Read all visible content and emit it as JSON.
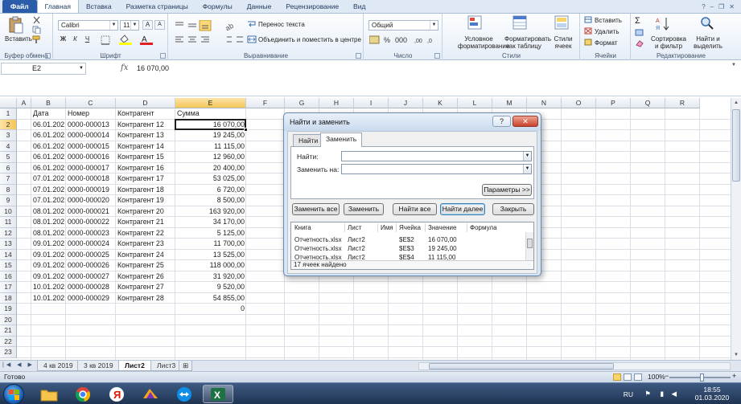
{
  "tabs": [
    "Файл",
    "Главная",
    "Вставка",
    "Разметка страницы",
    "Формулы",
    "Данные",
    "Рецензирование",
    "Вид"
  ],
  "ribbon": {
    "clipboard": {
      "paste": "Вставить",
      "label": "Буфер обмена"
    },
    "font": {
      "name": "Calibri",
      "size": "11",
      "label": "Шрифт"
    },
    "alignment": {
      "wrap": "Перенос текста",
      "merge": "Объединить и поместить в центре",
      "label": "Выравнивание"
    },
    "number": {
      "format": "Общий",
      "label": "Число"
    },
    "styles": {
      "conditional": "Условное форматирование",
      "table": "Форматировать как таблицу",
      "cell_styles": "Стили ячеек",
      "label": "Стили"
    },
    "cells": {
      "insert": "Вставить",
      "delete": "Удалить",
      "format": "Формат",
      "label": "Ячейки"
    },
    "editing": {
      "sort": "Сортировка и фильтр",
      "find": "Найти и выделить",
      "label": "Редактирование"
    }
  },
  "formula_bar": {
    "name_box": "E2",
    "fx": "fx",
    "value": "16 070,00"
  },
  "columns": [
    "A",
    "B",
    "C",
    "D",
    "E",
    "F",
    "G",
    "H",
    "I",
    "J",
    "K",
    "L",
    "M",
    "N",
    "O",
    "P",
    "Q",
    "R"
  ],
  "rows": [
    "1",
    "2",
    "3",
    "4",
    "5",
    "6",
    "7",
    "8",
    "9",
    "10",
    "11",
    "12",
    "13",
    "14",
    "15",
    "16",
    "17",
    "18",
    "19",
    "20",
    "21",
    "22",
    "23"
  ],
  "table": {
    "headers": [
      "Дата",
      "Номер",
      "Контрагент",
      "Сумма"
    ],
    "records": [
      [
        "06.01.2020",
        "0000-000013",
        "Контрагент 12",
        "16 070,00"
      ],
      [
        "06.01.2020",
        "0000-000014",
        "Контрагент 13",
        "19 245,00"
      ],
      [
        "06.01.2020",
        "0000-000015",
        "Контрагент 14",
        "11 115,00"
      ],
      [
        "06.01.2020",
        "0000-000016",
        "Контрагент 15",
        "12 960,00"
      ],
      [
        "06.01.2020",
        "0000-000017",
        "Контрагент 16",
        "20 400,00"
      ],
      [
        "07.01.2020",
        "0000-000018",
        "Контрагент 17",
        "53 025,00"
      ],
      [
        "07.01.2020",
        "0000-000019",
        "Контрагент 18",
        "6 720,00"
      ],
      [
        "07.01.2020",
        "0000-000020",
        "Контрагент 19",
        "8 500,00"
      ],
      [
        "08.01.2020",
        "0000-000021",
        "Контрагент 20",
        "163 920,00"
      ],
      [
        "08.01.2020",
        "0000-000022",
        "Контрагент 21",
        "34 170,00"
      ],
      [
        "08.01.2020",
        "0000-000023",
        "Контрагент 22",
        "5 125,00"
      ],
      [
        "09.01.2020",
        "0000-000024",
        "Контрагент 23",
        "11 700,00"
      ],
      [
        "09.01.2020",
        "0000-000025",
        "Контрагент 24",
        "13 525,00"
      ],
      [
        "09.01.2020",
        "0000-000026",
        "Контрагент 25",
        "118 000,00"
      ],
      [
        "09.01.2020",
        "0000-000027",
        "Контрагент 26",
        "31 920,00"
      ],
      [
        "10.01.2020",
        "0000-000028",
        "Контрагент 27",
        "9 520,00"
      ],
      [
        "10.01.2020",
        "0000-000029",
        "Контрагент 28",
        "54 855,00"
      ]
    ],
    "e19": "0"
  },
  "sheets": [
    "4 кв 2019",
    "3 кв 2019",
    "Лист2",
    "Лист3"
  ],
  "active_sheet": "Лист2",
  "status": {
    "ready": "Готово",
    "zoom": "100%"
  },
  "taskbar": {
    "lang": "RU",
    "time": "18:55",
    "date": "01.03.2020"
  },
  "dialog": {
    "title": "Найти и заменить",
    "help": "?",
    "close": "✕",
    "tabs": [
      "Найти",
      "Заменить"
    ],
    "active_tab": "Заменить",
    "find_label": "Найти:",
    "replace_label": "Заменить на:",
    "find_value": "",
    "replace_value": "",
    "options_btn": "Параметры >>",
    "buttons": [
      "Заменить все",
      "Заменить",
      "Найти все",
      "Найти далее",
      "Закрыть"
    ],
    "columns": [
      "Книга",
      "Лист",
      "Имя",
      "Ячейка",
      "Значение",
      "Формула"
    ],
    "results": [
      [
        "Отчетность.xlsx",
        "Лист2",
        "",
        "$E$2",
        "16 070,00",
        ""
      ],
      [
        "Отчетность.xlsx",
        "Лист2",
        "",
        "$E$3",
        "19 245,00",
        ""
      ],
      [
        "Отчетность.xlsx",
        "Лист2",
        "",
        "$E$4",
        "11 115,00",
        ""
      ]
    ],
    "footer": "17 ячеек найдено"
  },
  "colors": {
    "accent": "#2a5caa",
    "selection": "#f5c557",
    "excel_green": "#1e7145"
  }
}
